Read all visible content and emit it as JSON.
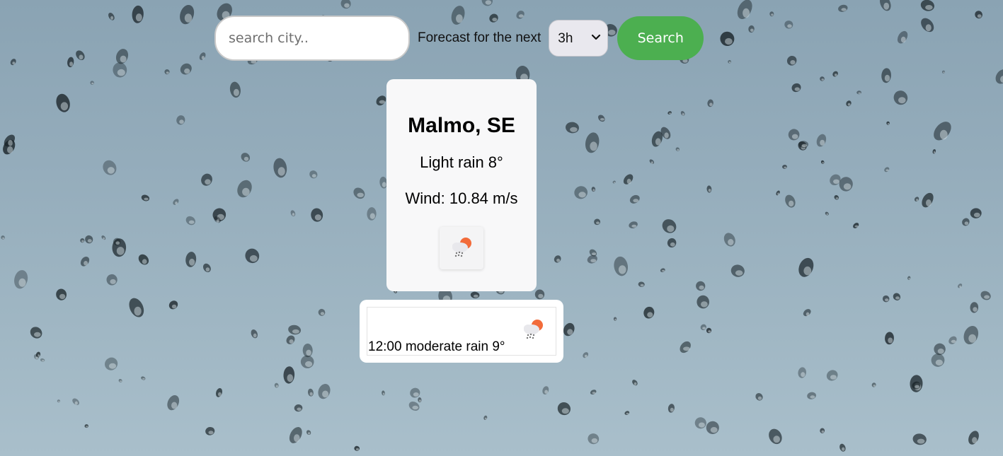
{
  "search": {
    "placeholder": "search city..",
    "value": ""
  },
  "forecast_label": "Forecast for the next",
  "hours_select": {
    "selected": "3h"
  },
  "search_button_label": "Search",
  "current": {
    "city": "Malmo, SE",
    "condition": "Light rain 8°",
    "wind": "Wind: 10.84 m/s",
    "icon": "light-rain-sun-icon"
  },
  "forecast": [
    {
      "text": "12:00 moderate rain 9°",
      "icon": "moderate-rain-sun-icon"
    }
  ],
  "colors": {
    "search_button": "#4caf50",
    "card_background": "#f8f8f9",
    "sun_icon": "#f26b3a",
    "cloud_icon": "#e8e8ec"
  }
}
